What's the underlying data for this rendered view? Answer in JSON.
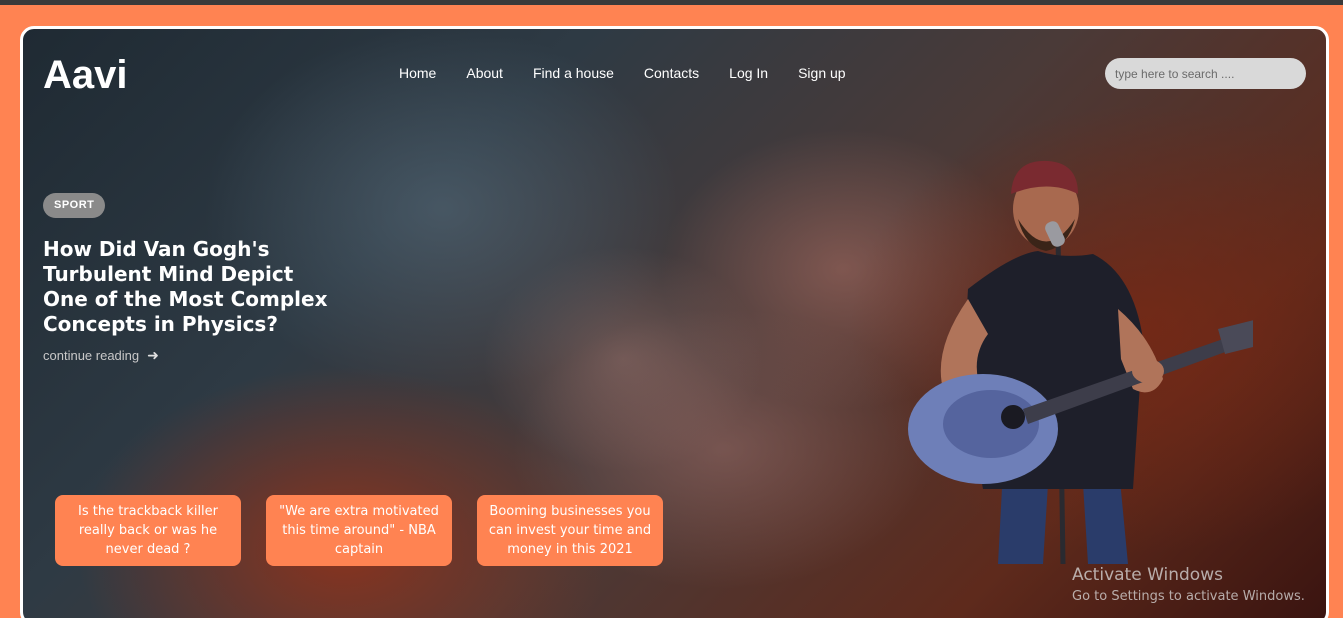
{
  "brand": {
    "logo": "Aavi"
  },
  "nav": {
    "items": [
      {
        "label": "Home"
      },
      {
        "label": "About"
      },
      {
        "label": "Find a house"
      },
      {
        "label": "Contacts"
      },
      {
        "label": "Log In"
      },
      {
        "label": "Sign up"
      }
    ]
  },
  "search": {
    "placeholder": "type here to search ....",
    "value": ""
  },
  "hero": {
    "category": "SPORT",
    "headline": "How Did Van Gogh's Turbulent Mind Depict One of the Most Complex Concepts in Physics?",
    "cta": "continue reading",
    "cta_icon": "arrow-right-icon"
  },
  "cards": [
    {
      "text": "Is the trackback killer really back or was he never dead ?"
    },
    {
      "text": "\"We are extra motivated this time around\" - NBA captain"
    },
    {
      "text": "Booming businesses you can invest your time and money in this 2021"
    }
  ],
  "watermark": {
    "title": "Activate Windows",
    "subtitle": "Go to Settings to activate Windows."
  },
  "colors": {
    "accent": "#ff8352",
    "badge": "#8a8a8a",
    "search_bg": "#d9d9d9"
  }
}
